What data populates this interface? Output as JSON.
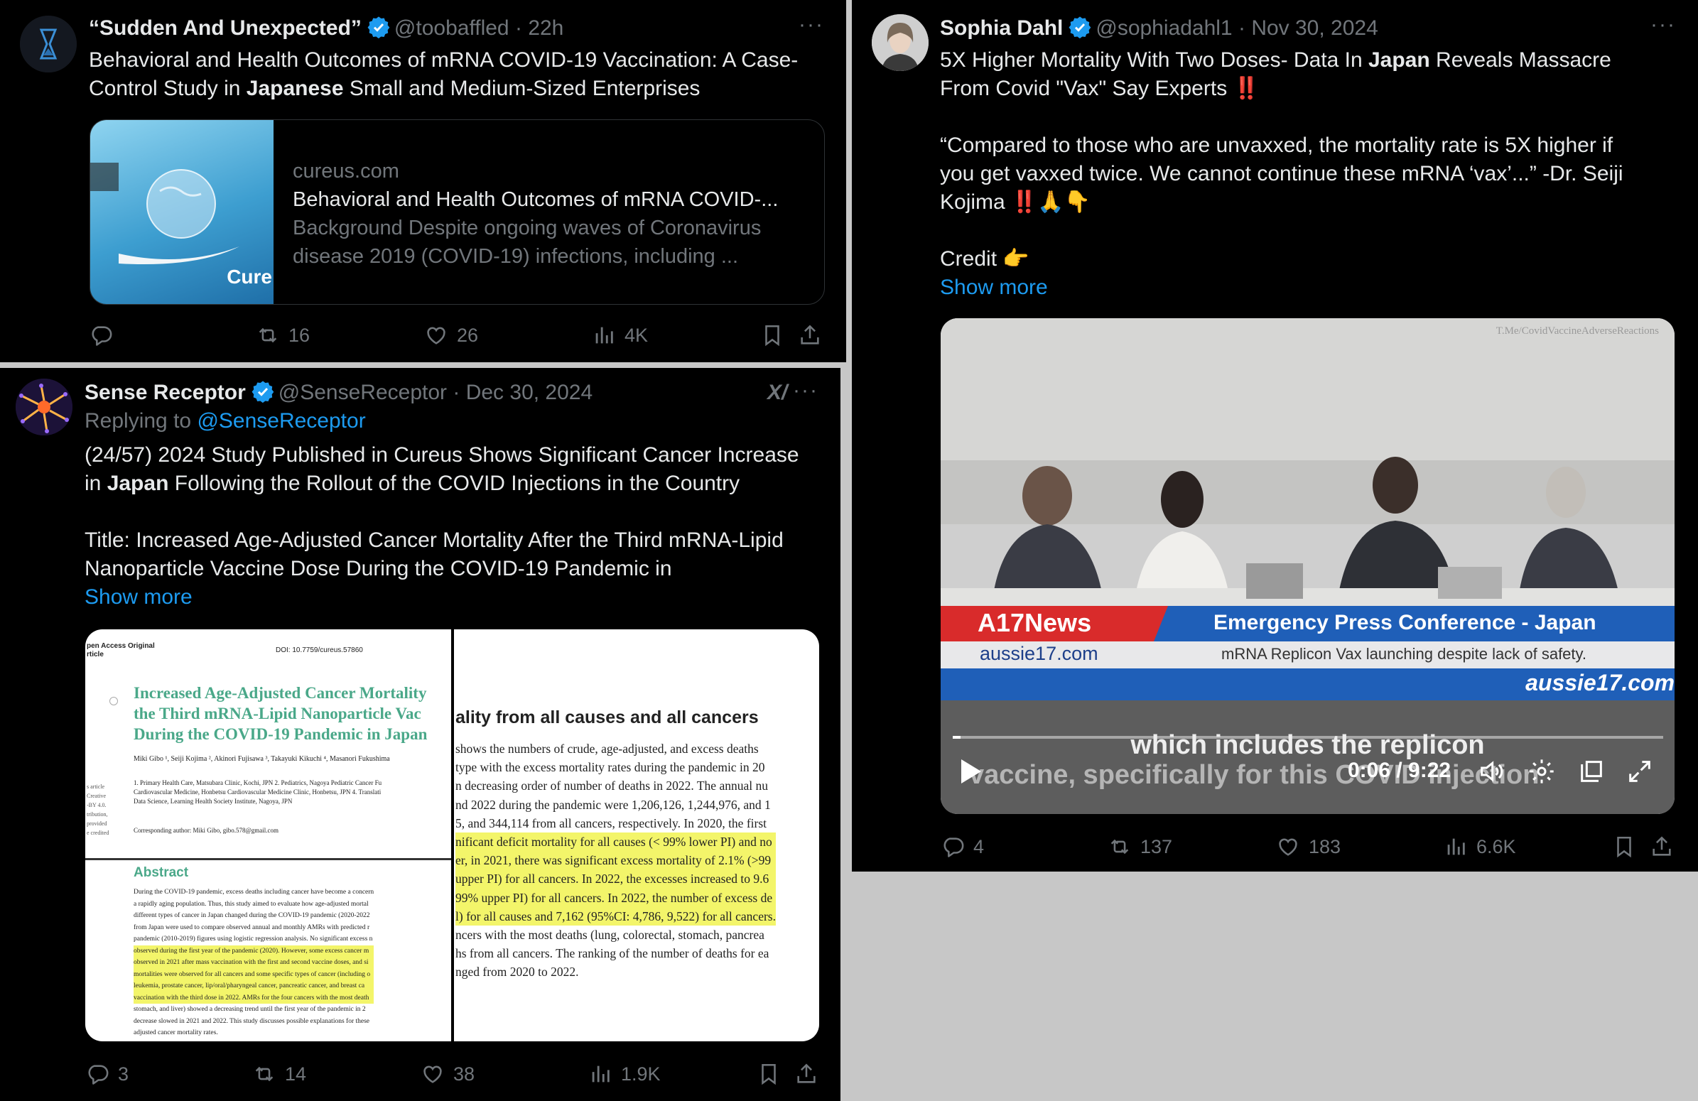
{
  "tweet1": {
    "name": "“Sudden And Unexpected”",
    "handle": "@toobaffled",
    "sep": "·",
    "time": "22h",
    "text_a": "Behavioral and Health Outcomes of mRNA COVID-19 Vaccination: A Case-",
    "text_b1": "Control Study in ",
    "text_b_bold": "Japanese",
    "text_b2": " Small and Medium-Sized Enterprises",
    "card": {
      "domain": "cureus.com",
      "title": "Behavioral and Health Outcomes of mRNA COVID-...",
      "desc_a": "Background Despite ongoing waves of Coronavirus",
      "desc_b": "disease 2019 (COVID-19) infections, including ...",
      "logo_text": "Cure"
    },
    "stats": {
      "replies": "",
      "reposts": "16",
      "likes": "26",
      "views": "4K"
    }
  },
  "tweet2": {
    "name": "Sense Receptor",
    "handle": "@SenseReceptor",
    "sep": "·",
    "time": "Dec 30, 2024",
    "replying_prefix": "Replying to ",
    "replying_to": "@SenseReceptor",
    "text_a": "(24/57) 2024 Study Published in Cureus Shows Significant Cancer Increase",
    "text_b_bold": "Japan",
    "text_b1": "in ",
    "text_b2": " Following the Rollout of the COVID Injections in the Country",
    "text_c": "Title: Increased Age-Adjusted Cancer Mortality After the Third mRNA-Lipid",
    "text_d": "Nanoparticle Vaccine Dose During the COVID-19 Pandemic in",
    "show_more": "Show more",
    "grok_label": "X/",
    "paper": {
      "access": "pen Access Original",
      "article": "rticle",
      "doi": "DOI: 10.7759/cureus.57860",
      "title_a": "Increased Age-Adjusted Cancer Mortality",
      "title_b": "the Third mRNA-Lipid Nanoparticle Vac",
      "title_c": "During the COVID-19 Pandemic in Japan",
      "authors": "Miki Gibo ¹, Seiji Kojima ², Akinori Fujisawa ³, Takayuki Kikuchi ⁴, Masanori Fukushima",
      "affil_a": "1. Primary Health Care, Matsubara Clinic, Kochi, JPN 2. Pediatrics, Nagoya Pediatric Cancer Fu",
      "affil_b": "Cardiovascular Medicine, Honbetsu Cardiovascular Medicine Clinic, Honbetsu, JPN 4. Translati",
      "affil_c": "Data Science, Learning Health Society Institute, Nagoya, JPN",
      "corresponding": "Corresponding author: Miki Gibo, gibo.578@gmail.com",
      "side_notes": [
        "s article",
        "Creative",
        "-BY 4.0.",
        "tribution,",
        "provided",
        "e credited"
      ],
      "abstract_head": "Abstract",
      "abstract_lines": [
        "During the COVID-19 pandemic, excess deaths including cancer have become a concern",
        "a rapidly aging population. Thus, this study aimed to evaluate how age-adjusted mortal",
        "different types of cancer in Japan changed during the COVID-19 pandemic (2020-2022",
        "from Japan were used to compare observed annual and monthly AMRs with predicted r",
        "pandemic (2010-2019) figures using logistic regression analysis. No significant excess n",
        "observed during the first year of the pandemic (2020). However, some excess cancer m",
        "observed in 2021 after mass vaccination with the first and second vaccine doses, and si",
        "mortalities were observed for all cancers and some specific types of cancer (including o",
        "leukemia, prostate cancer, lip/oral/pharyngeal cancer, pancreatic cancer, and breast ca",
        "vaccination with the third dose in 2022. AMRs for the four cancers with the most death",
        "stomach, and liver) showed a decreasing trend until the first year of the pandemic in 2",
        "decrease slowed in 2021 and 2022. This study discusses possible explanations for these",
        "adjusted cancer mortality rates."
      ],
      "right_head": "ality from all causes and all cancers",
      "right_lines": [
        " shows the numbers of crude, age-adjusted, and excess deaths",
        "type with the excess mortality rates during the pandemic in 20",
        "n decreasing order of number of deaths in 2022. The annual nu",
        "nd 2022 during the pandemic were 1,206,126, 1,244,976, and 1",
        "5, and 344,114 from all cancers, respectively. In 2020, the first",
        "nificant deficit mortality for all causes (< 99% lower PI) and no",
        "er, in 2021, there was significant excess mortality of 2.1% (>99",
        "upper PI) for all cancers. In 2022, the excesses increased to 9.6",
        "99% upper PI) for all cancers. In 2022, the number of excess de",
        "l) for all causes and 7,162 (95%CI: 4,786, 9,522) for all cancers.",
        "ncers with the most deaths (lung, colorectal, stomach, pancrea",
        "hs from all cancers. The ranking of the number of deaths for ea",
        "nged from 2020 to 2022."
      ]
    },
    "stats": {
      "replies": "3",
      "reposts": "14",
      "likes": "38",
      "views": "1.9K"
    }
  },
  "tweet3": {
    "name": "Sophia Dahl",
    "handle": "@sophiadahl1",
    "sep": "·",
    "time": "Nov 30, 2024",
    "text_a1": "5X Higher Mortality With Two Doses-  Data In ",
    "text_a_bold": "Japan",
    "text_a2": " Reveals Massacre",
    "text_b": "From Covid \"Vax\" Say Experts ‼️",
    "text_c": "“Compared to those who are unvaxxed, the mortality rate is 5X higher if",
    "text_d": "you get vaxxed twice. We cannot continue these mRNA ‘vax’...” -Dr. Seiji",
    "text_e": "Kojima ‼️🙏👇",
    "text_f": "Credit 👉",
    "show_more": "Show more",
    "video": {
      "watermark": "T.Me/CovidVaccineAdverseReactions",
      "channel": "A17News",
      "site": "aussie17.com",
      "headline": "Emergency Press Conference - Japan",
      "subhead": "mRNA Replicon Vax launching despite lack of safety.",
      "site2": "aussie17.com",
      "caption_a": "which includes the replicon",
      "caption_b": "vaccine, specifically for this COVID injection",
      "time": "0:06 / 9:22",
      "progress": 0.011
    },
    "stats": {
      "replies": "4",
      "reposts": "137",
      "likes": "183",
      "views": "6.6K"
    }
  },
  "more_glyph": "···"
}
